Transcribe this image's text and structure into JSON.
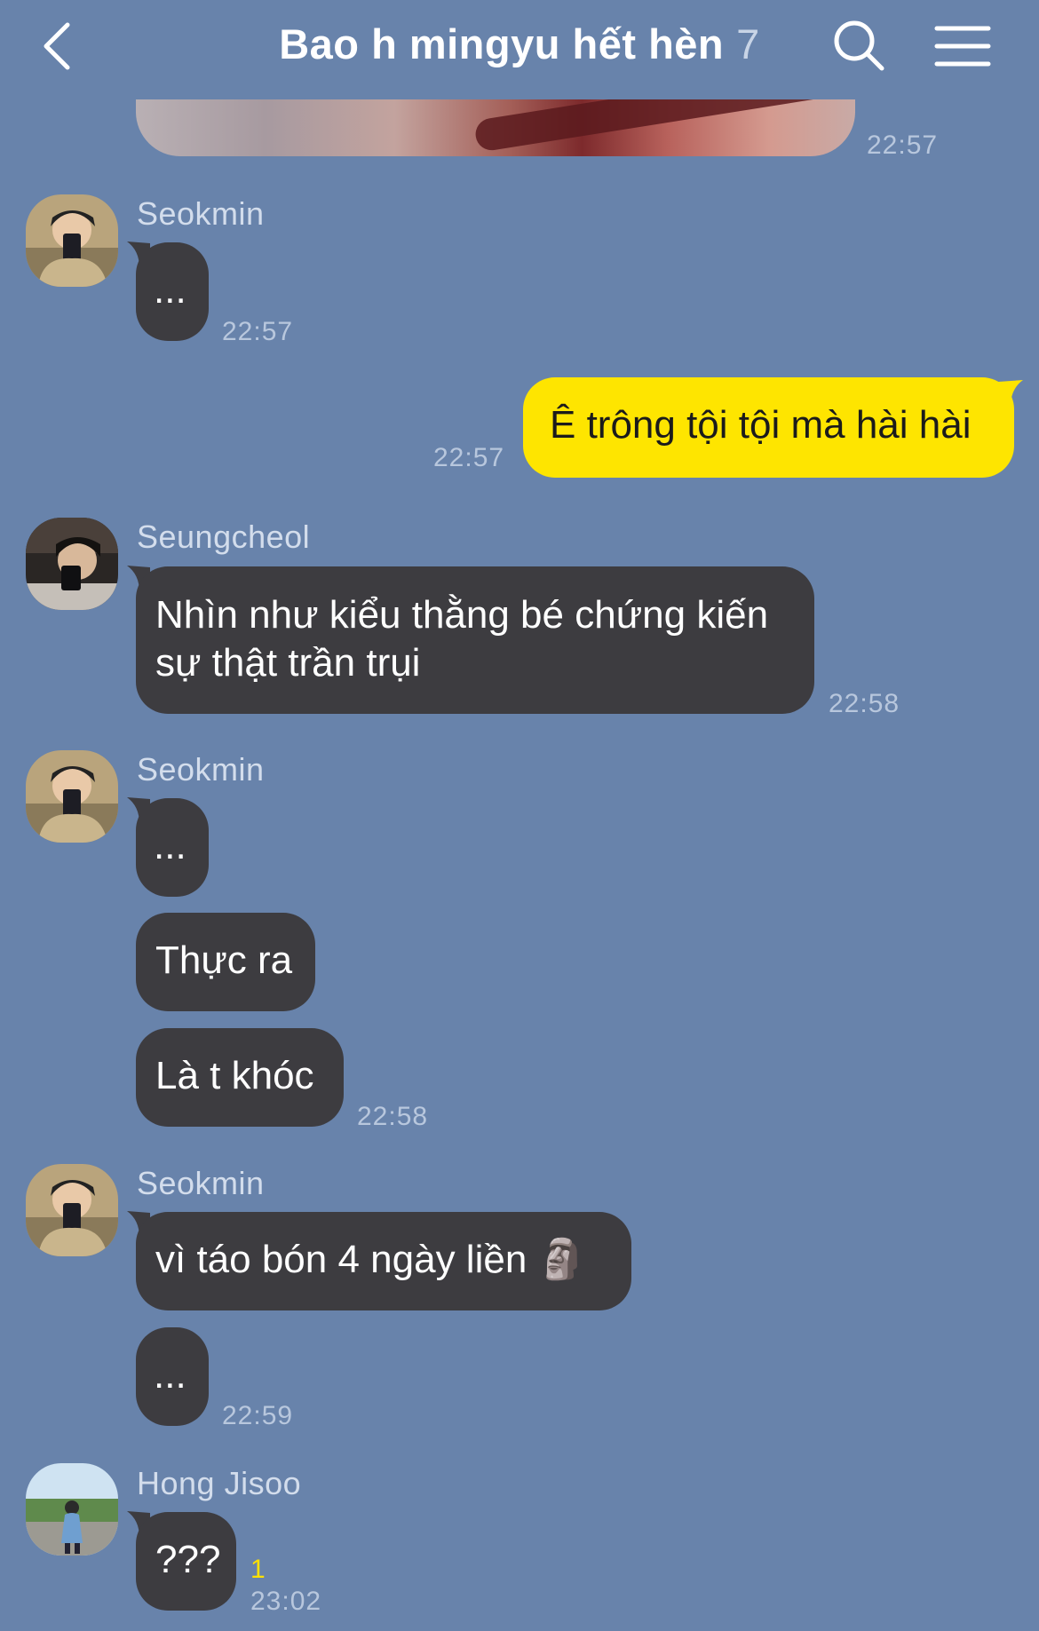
{
  "header": {
    "title": "Bao h mingyu hết hèn",
    "member_count": "7"
  },
  "icons": {
    "back": "chevron-left-icon",
    "search": "search-icon",
    "menu": "hamburger-menu-icon"
  },
  "colors": {
    "background": "#6883ab",
    "their_bubble": "#3d3c40",
    "my_bubble": "#fee500",
    "timestamp": "#b8c7dd",
    "unread": "#ffe100"
  },
  "messages": [
    {
      "type": "photo",
      "mine": false,
      "time": "22:57"
    },
    {
      "sender": "Seokmin",
      "mine": false,
      "bubbles": [
        "..."
      ],
      "time": "22:57"
    },
    {
      "mine": true,
      "bubbles": [
        "Ê trông tội tội mà hài hài"
      ],
      "time": "22:57"
    },
    {
      "sender": "Seungcheol",
      "mine": false,
      "bubbles": [
        "Nhìn như kiểu thằng bé chứng kiến sự thật trần trụi"
      ],
      "time": "22:58"
    },
    {
      "sender": "Seokmin",
      "mine": false,
      "bubbles": [
        "...",
        "Thực ra",
        "Là t khóc"
      ],
      "time": "22:58"
    },
    {
      "sender": "Seokmin",
      "mine": false,
      "bubbles": [
        "vì táo bón 4 ngày liền 🗿",
        "..."
      ],
      "time": "22:59"
    },
    {
      "sender": "Hong Jisoo",
      "mine": false,
      "bubbles": [
        "???"
      ],
      "time": "23:02",
      "unread": "1"
    }
  ]
}
